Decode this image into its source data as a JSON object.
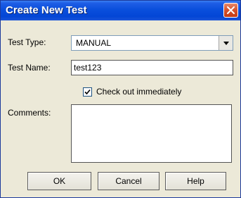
{
  "window": {
    "title": "Create New Test"
  },
  "form": {
    "test_type": {
      "label": "Test Type:",
      "value": "MANUAL"
    },
    "test_name": {
      "label": "Test Name:",
      "value": "test123"
    },
    "checkout": {
      "label": "Check out immediately",
      "checked": true
    },
    "comments": {
      "label": "Comments:",
      "value": ""
    }
  },
  "buttons": {
    "ok": "OK",
    "cancel": "Cancel",
    "help": "Help"
  },
  "colors": {
    "titlebar": "#0a4fdc",
    "dialog_background": "#ece9d8",
    "close_button": "#d7542f"
  },
  "icons": {
    "close": "close-icon",
    "dropdown": "chevron-down-icon",
    "check": "checkmark-icon"
  }
}
